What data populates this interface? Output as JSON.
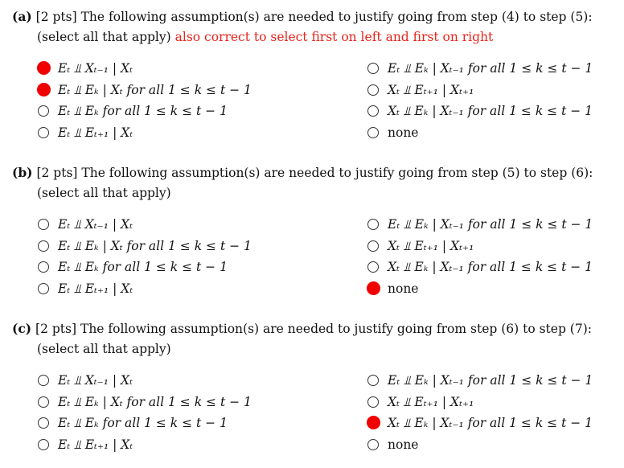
{
  "questions": [
    {
      "label": "(a)",
      "points": "[2 pts]",
      "prompt": "The following assumption(s) are needed to justify going from step (4) to step (5):",
      "instruction": "(select all that apply)",
      "note": "also correct to select first on left and first on right",
      "options_left": [
        {
          "text": "Eₜ ⫫ Xₜ₋₁ | Xₜ",
          "selected": true
        },
        {
          "text": "Eₜ ⫫ Eₖ | Xₜ for all 1 ≤ k ≤ t − 1",
          "selected": true
        },
        {
          "text": "Eₜ ⫫ Eₖ for all 1 ≤ k ≤ t − 1",
          "selected": false
        },
        {
          "text": "Eₜ ⫫ Eₜ₊₁ | Xₜ",
          "selected": false
        }
      ],
      "options_right": [
        {
          "text": "Eₜ ⫫ Eₖ | Xₜ₋₁ for all 1 ≤ k ≤ t − 1",
          "selected": false
        },
        {
          "text": "Xₜ ⫫ Eₜ₊₁ | Xₜ₊₁",
          "selected": false
        },
        {
          "text": "Xₜ ⫫ Eₖ | Xₜ₋₁ for all 1 ≤ k ≤ t − 1",
          "selected": false
        },
        {
          "text": "none",
          "selected": false
        }
      ]
    },
    {
      "label": "(b)",
      "points": "[2 pts]",
      "prompt": "The following assumption(s) are needed to justify going from step (5) to step (6):",
      "instruction": "(select all that apply)",
      "note": "",
      "options_left": [
        {
          "text": "Eₜ ⫫ Xₜ₋₁ | Xₜ",
          "selected": false
        },
        {
          "text": "Eₜ ⫫ Eₖ | Xₜ for all 1 ≤ k ≤ t − 1",
          "selected": false
        },
        {
          "text": "Eₜ ⫫ Eₖ for all 1 ≤ k ≤ t − 1",
          "selected": false
        },
        {
          "text": "Eₜ ⫫ Eₜ₊₁ | Xₜ",
          "selected": false
        }
      ],
      "options_right": [
        {
          "text": "Eₜ ⫫ Eₖ | Xₜ₋₁ for all 1 ≤ k ≤ t − 1",
          "selected": false
        },
        {
          "text": "Xₜ ⫫ Eₜ₊₁ | Xₜ₊₁",
          "selected": false
        },
        {
          "text": "Xₜ ⫫ Eₖ | Xₜ₋₁ for all 1 ≤ k ≤ t − 1",
          "selected": false
        },
        {
          "text": "none",
          "selected": true
        }
      ]
    },
    {
      "label": "(c)",
      "points": "[2 pts]",
      "prompt": "The following assumption(s) are needed to justify going from step (6) to step (7):",
      "instruction": "(select all that apply)",
      "note": "",
      "options_left": [
        {
          "text": "Eₜ ⫫ Xₜ₋₁ | Xₜ",
          "selected": false
        },
        {
          "text": "Eₜ ⫫ Eₖ | Xₜ for all 1 ≤ k ≤ t − 1",
          "selected": false
        },
        {
          "text": "Eₜ ⫫ Eₖ for all 1 ≤ k ≤ t − 1",
          "selected": false
        },
        {
          "text": "Eₜ ⫫ Eₜ₊₁ | Xₜ",
          "selected": false
        }
      ],
      "options_right": [
        {
          "text": "Eₜ ⫫ Eₖ | Xₜ₋₁ for all 1 ≤ k ≤ t − 1",
          "selected": false
        },
        {
          "text": "Xₜ ⫫ Eₜ₊₁ | Xₜ₊₁",
          "selected": false
        },
        {
          "text": "Xₜ ⫫ Eₖ | Xₜ₋₁ for all 1 ≤ k ≤ t − 1",
          "selected": true
        },
        {
          "text": "none",
          "selected": false
        }
      ]
    }
  ],
  "colors": {
    "selected": "#f00000",
    "note": "#e8241c"
  }
}
